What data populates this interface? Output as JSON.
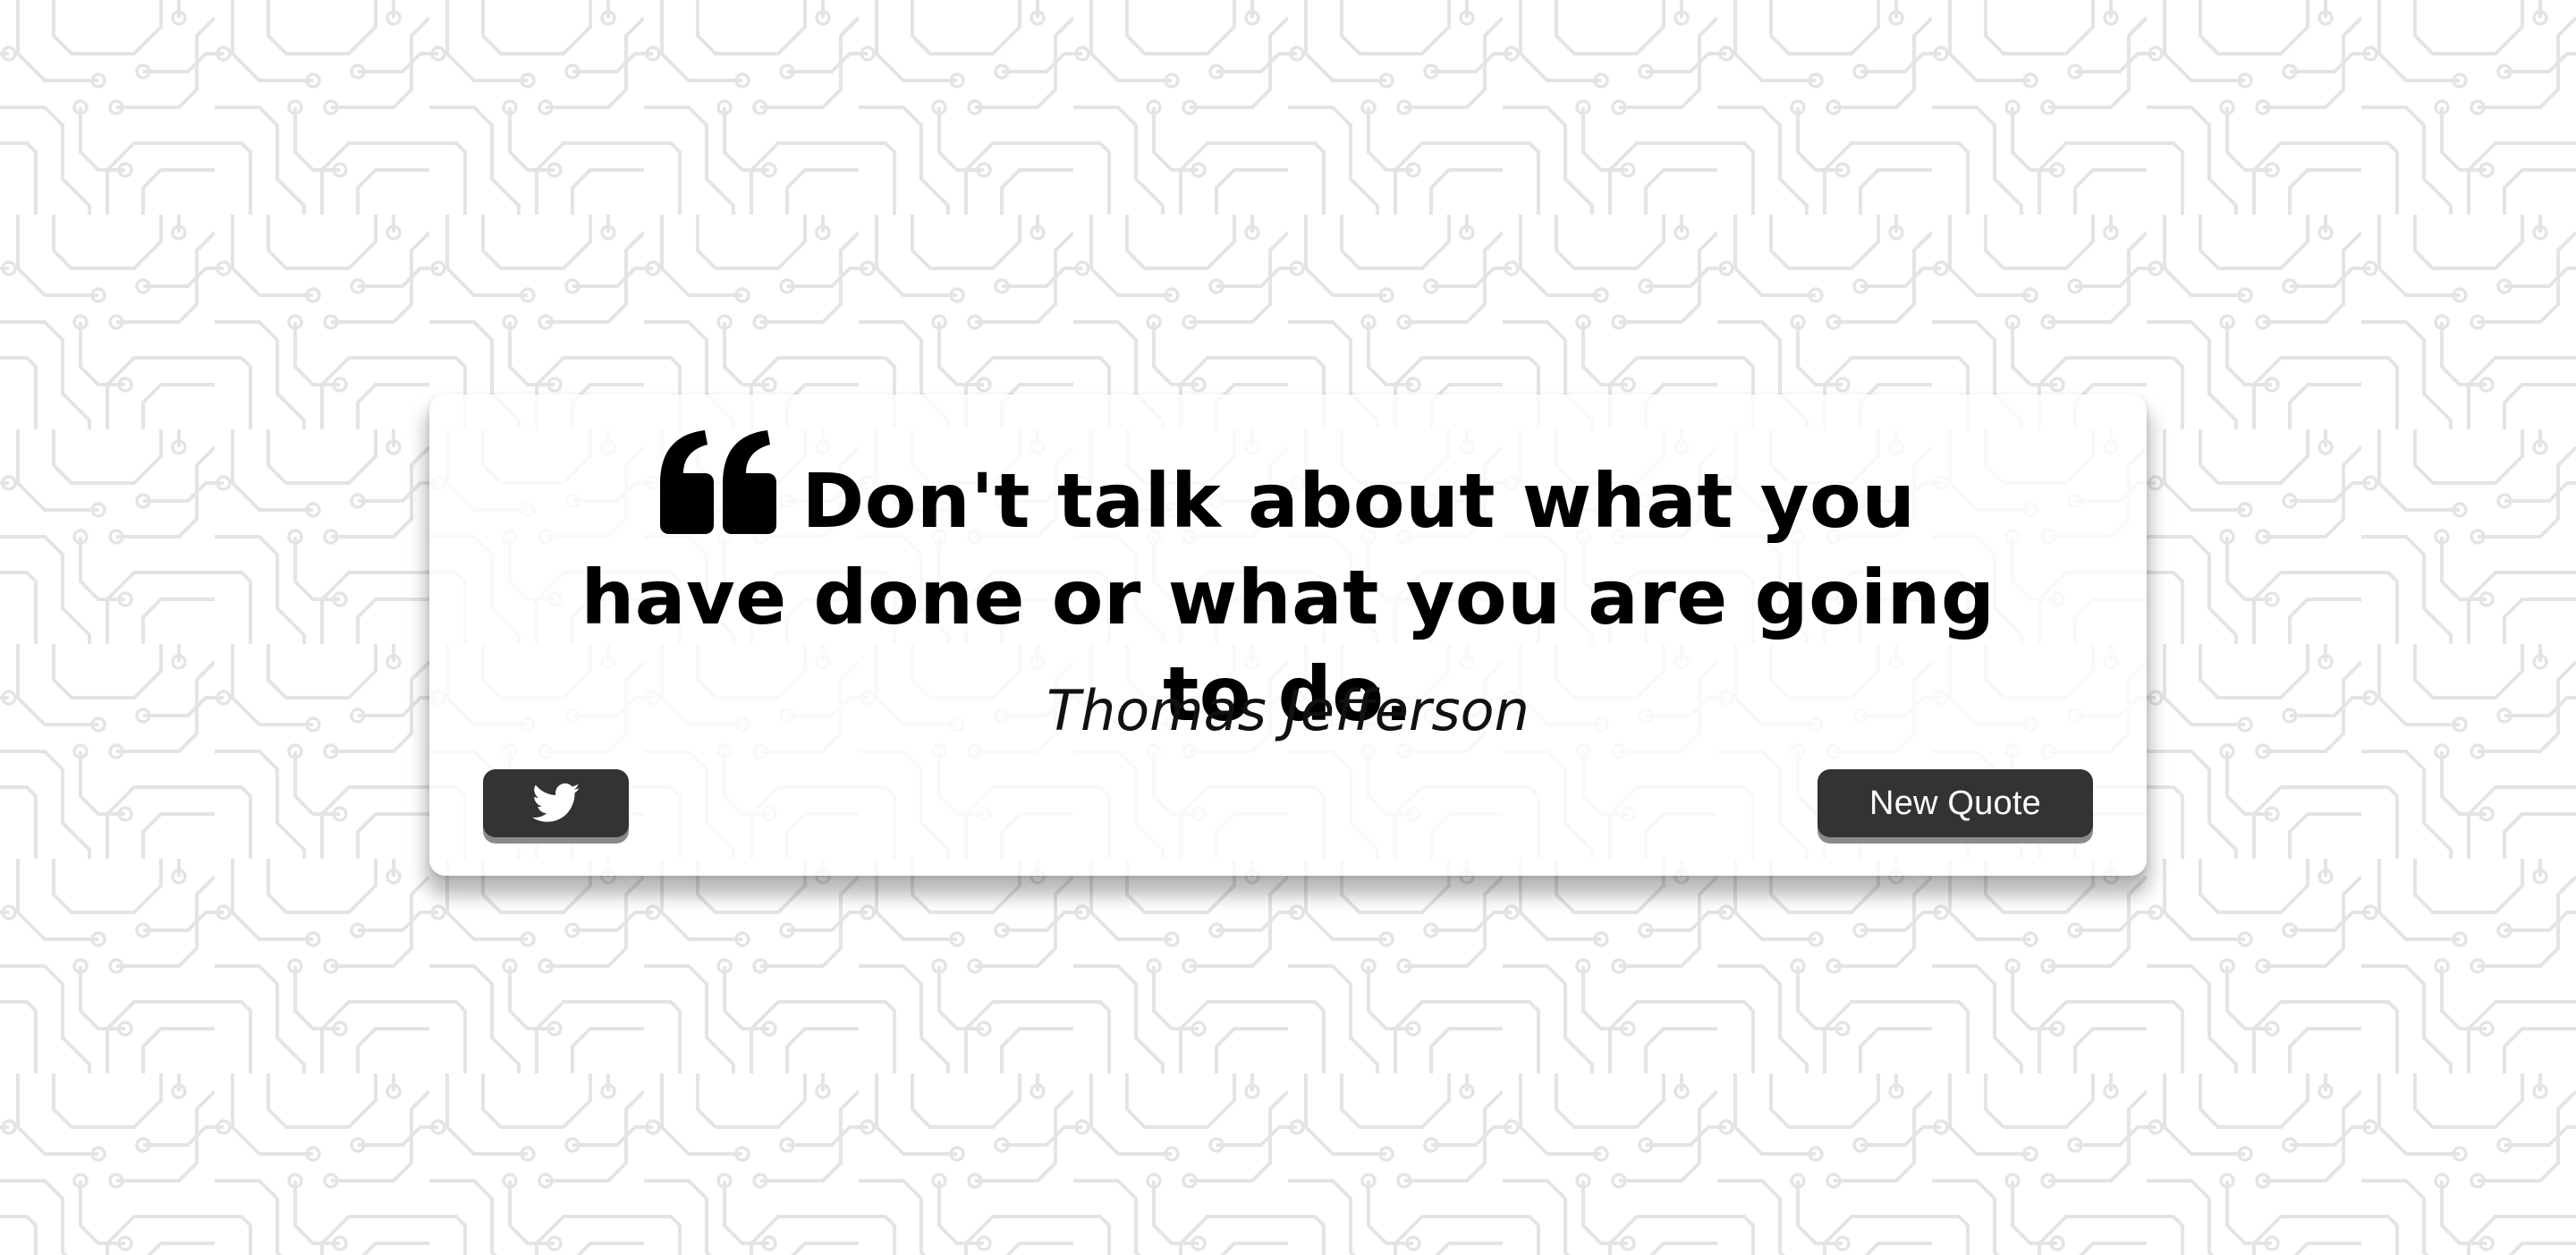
{
  "quote": {
    "text": "Don't talk about what you have done or what you are going to do.",
    "author": "Thomas Jefferson",
    "icon": "quote-left-icon"
  },
  "actions": {
    "tweet_icon": "twitter-icon",
    "new_quote_label": "New Quote"
  },
  "theme": {
    "card_background": "#ffffff",
    "button_color": "#333333",
    "button_shadow": "#8a8a8a",
    "pattern_color": "#e6e6e6"
  }
}
